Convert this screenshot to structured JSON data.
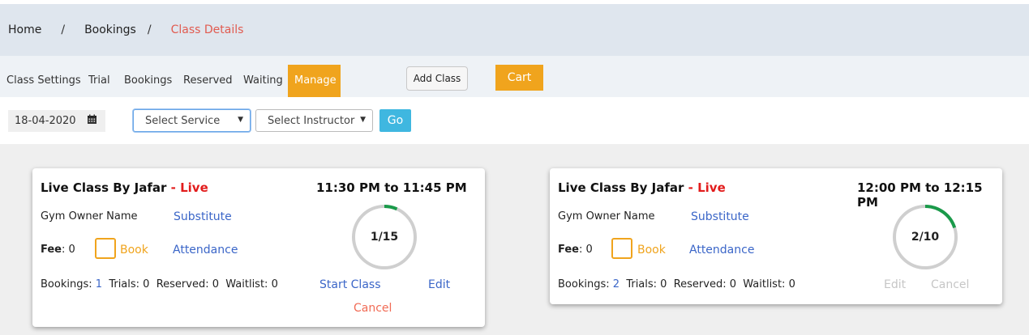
{
  "breadcrumb": {
    "home": "Home",
    "sep1": "/",
    "bookings": "Bookings",
    "sep2": "/",
    "current": "Class Details"
  },
  "tabs": [
    {
      "label": "Class Settings"
    },
    {
      "label": "Trial"
    },
    {
      "label": "Bookings"
    },
    {
      "label": "Reserved"
    },
    {
      "label": "Waiting"
    },
    {
      "label": "Manage"
    }
  ],
  "toolbar": {
    "add_class_label": "Add Class",
    "cart_label": "Cart"
  },
  "filters": {
    "date": "18-04-2020",
    "date_icon": "calendar-icon",
    "service_value": "Select Service",
    "instructor_value": "Select Instructor",
    "go_label": "Go",
    "caret": "▼"
  },
  "cards": [
    {
      "title": "Live Class By Jafar",
      "live_tag": "- Live",
      "time": "11:30 PM to 11:45 PM",
      "owner": "Gym Owner Name",
      "substitute": "Substitute",
      "fee_label": "Fee",
      "fee_value": ": 0",
      "book_label": "Book",
      "attendance_label": "Attendance",
      "capacity_text": "1/15",
      "capacity_fraction": 0.0667,
      "bookings_label": "Bookings:",
      "bookings_value": "1",
      "trials_text": "Trials: 0",
      "reserved_text": "Reserved: 0",
      "waitlist_text": "Waitlist: 0",
      "start_class_label": "Start Class",
      "edit_label": "Edit",
      "cancel_label": "Cancel"
    },
    {
      "title": "Live Class By Jafar",
      "live_tag": "- Live",
      "time": "12:00 PM to 12:15 PM",
      "owner": "Gym Owner Name",
      "substitute": "Substitute",
      "fee_label": "Fee",
      "fee_value": ": 0",
      "book_label": "Book",
      "attendance_label": "Attendance",
      "capacity_text": "2/10",
      "capacity_fraction": 0.2,
      "bookings_label": "Bookings:",
      "bookings_value": "2",
      "trials_text": "Trials: 0",
      "reserved_text": "Reserved: 0",
      "waitlist_text": "Waitlist: 0",
      "edit_label": "Edit",
      "cancel_label": "Cancel"
    }
  ],
  "colors": {
    "accent_orange": "#f0a41d",
    "live_red": "#e21c1c",
    "link_blue": "#3b66c8",
    "ring_progress": "#1a9a4a",
    "ring_track": "#cfcfcf",
    "go_blue": "#3fb7e0"
  }
}
